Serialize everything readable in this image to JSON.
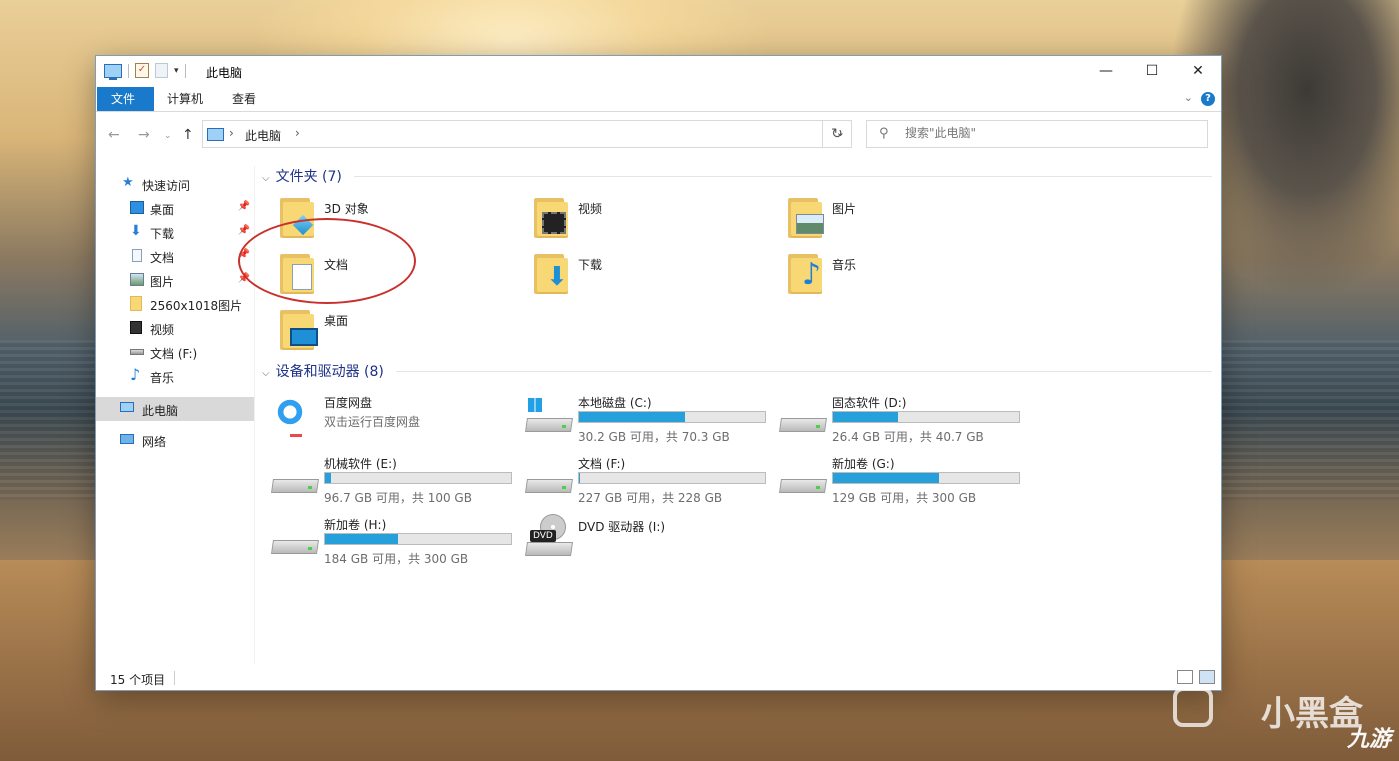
{
  "window": {
    "title": "此电脑",
    "minimize": "—",
    "maximize": "☐",
    "close": "✕"
  },
  "ribbon": {
    "tabs": [
      "文件",
      "计算机",
      "查看"
    ],
    "help": "?"
  },
  "address": {
    "crumb": "此电脑",
    "search_placeholder": "搜索\"此电脑\""
  },
  "sidebar": {
    "items": [
      {
        "label": "快速访问",
        "icon": "star-icon"
      },
      {
        "label": "桌面",
        "icon": "desktop-icon",
        "pinned": true
      },
      {
        "label": "下载",
        "icon": "download-icon",
        "pinned": true
      },
      {
        "label": "文档",
        "icon": "document-icon",
        "pinned": true
      },
      {
        "label": "图片",
        "icon": "picture-icon",
        "pinned": true
      },
      {
        "label": "2560x1018图片",
        "icon": "folder-icon"
      },
      {
        "label": "视频",
        "icon": "video-icon"
      },
      {
        "label": "文档 (F:)",
        "icon": "drive-icon"
      },
      {
        "label": "音乐",
        "icon": "music-icon"
      },
      {
        "label": "此电脑",
        "icon": "computer-icon"
      },
      {
        "label": "网络",
        "icon": "network-icon"
      }
    ]
  },
  "folders": {
    "header": "文件夹 (7)",
    "items": [
      {
        "label": "3D 对象",
        "icon": "3d-objects-icon"
      },
      {
        "label": "视频",
        "icon": "video-folder-icon"
      },
      {
        "label": "图片",
        "icon": "pictures-folder-icon"
      },
      {
        "label": "文档",
        "icon": "documents-folder-icon"
      },
      {
        "label": "下载",
        "icon": "downloads-folder-icon"
      },
      {
        "label": "音乐",
        "icon": "music-folder-icon"
      },
      {
        "label": "桌面",
        "icon": "desktop-folder-icon"
      }
    ]
  },
  "devices": {
    "header": "设备和驱动器 (8)",
    "items": [
      {
        "name": "百度网盘",
        "sub": "双击运行百度网盘",
        "type": "app"
      },
      {
        "name": "本地磁盘 (C:)",
        "size": "30.2 GB 可用，共 70.3 GB",
        "used": 0.57,
        "type": "windows-drive"
      },
      {
        "name": "固态软件 (D:)",
        "size": "26.4 GB 可用，共 40.7 GB",
        "used": 0.35,
        "type": "drive"
      },
      {
        "name": "机械软件 (E:)",
        "size": "96.7 GB 可用，共 100 GB",
        "used": 0.033,
        "type": "drive"
      },
      {
        "name": "文档 (F:)",
        "size": "227 GB 可用，共 228 GB",
        "used": 0.005,
        "type": "drive"
      },
      {
        "name": "新加卷 (G:)",
        "size": "129 GB 可用，共 300 GB",
        "used": 0.57,
        "type": "drive"
      },
      {
        "name": "新加卷 (H:)",
        "size": "184 GB 可用，共 300 GB",
        "used": 0.39,
        "type": "drive"
      },
      {
        "name": "DVD 驱动器 (I:)",
        "type": "dvd",
        "badge": "DVD"
      }
    ]
  },
  "status": {
    "count": "15 个项目"
  },
  "watermark": {
    "text1": "小黑盒",
    "text2": "九游"
  },
  "colors": {
    "accent": "#1979ca",
    "bar": "#26a0da",
    "annotation": "#c9302c"
  }
}
